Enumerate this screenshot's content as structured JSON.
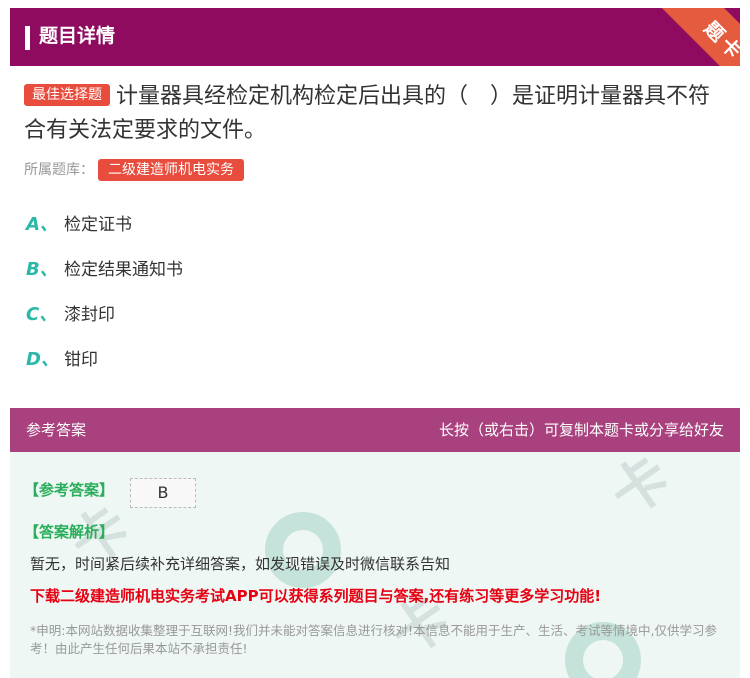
{
  "header": {
    "title": "题目详情",
    "corner_label": "题卡"
  },
  "question": {
    "badge": "最佳选择题",
    "text": "计量器具经检定机构检定后出具的（　）是证明计量器具不符合有关法定要求的文件。",
    "bank_label": "所属题库：",
    "bank_name": "二级建造师机电实务"
  },
  "options": [
    {
      "letter": "A、",
      "text": "检定证书"
    },
    {
      "letter": "B、",
      "text": "检定结果通知书"
    },
    {
      "letter": "C、",
      "text": "漆封印"
    },
    {
      "letter": "D、",
      "text": "钳印"
    }
  ],
  "answer_bar": {
    "left": "参考答案",
    "right": "长按（或右击）可复制本题卡或分享给好友"
  },
  "answer": {
    "ref_label": "【参考答案】",
    "value": "B",
    "analysis_label": "【答案解析】",
    "explanation": "暂无，时间紧后续补充详细答案，如发现错误及时微信联系告知",
    "promo": "下载二级建造师机电实务考试APP可以获得系列题目与答案,还有练习等更多学习功能!",
    "disclaimer": "*申明:本网站数据收集整理于互联网!我们并未能对答案信息进行核对!本信息不能用于生产、生活、考试等情境中,仅供学习参考！由此产生任何后果本站不承担责任!"
  },
  "colors": {
    "header": "#8e0b5f",
    "corner": "#e55b3d",
    "badge": "#e84c3d",
    "option_letter": "#2bb8a8",
    "answer_bar": "#a8417e",
    "answer_bg": "#eef7f4",
    "label_green": "#2bae5c",
    "promo_red": "#e60012"
  }
}
